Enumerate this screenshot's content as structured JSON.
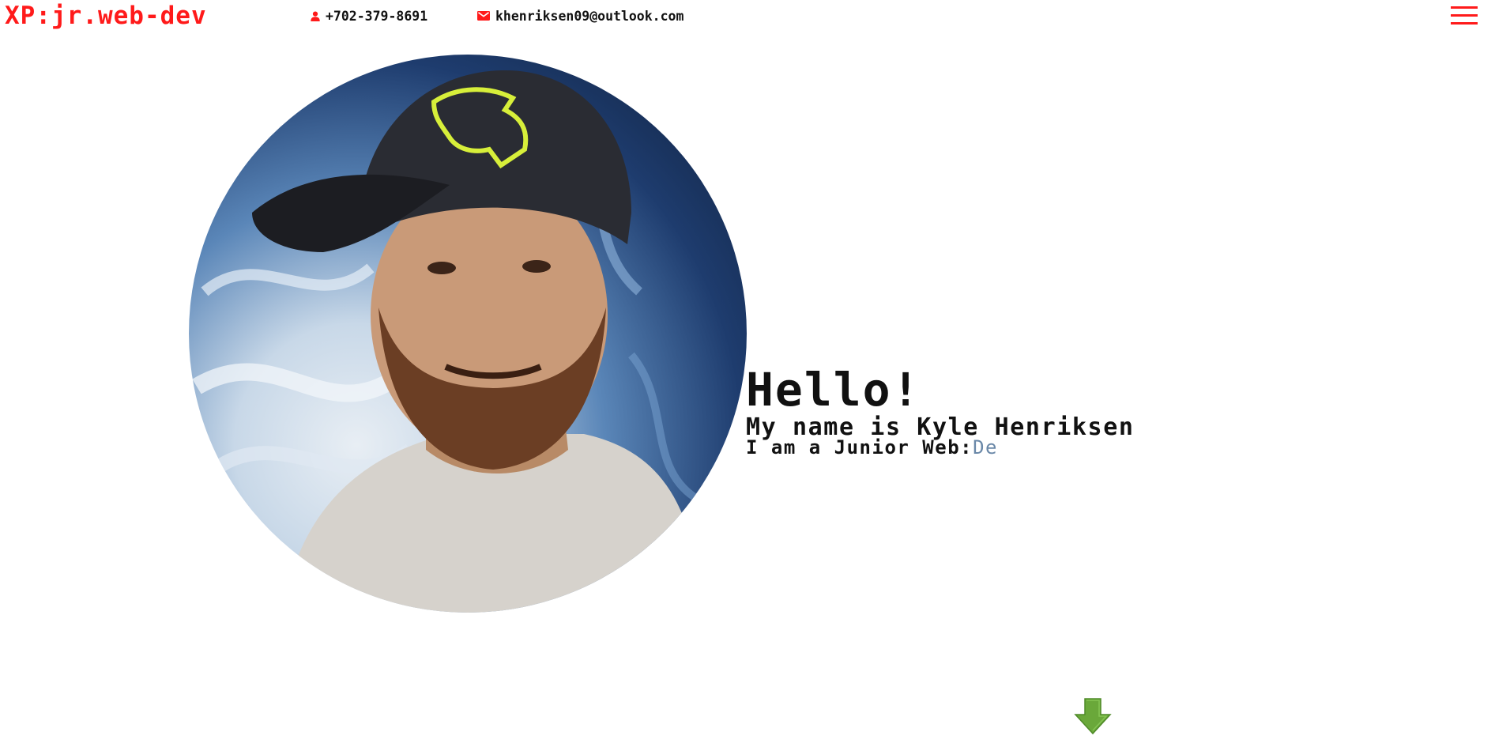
{
  "header": {
    "brand": "XP:jr.web-dev",
    "phone": "+702-379-8691",
    "email": "khenriksen09@outlook.com",
    "phone_icon": "person-icon",
    "email_icon": "envelope-icon",
    "menu_icon": "hamburger-menu-icon"
  },
  "hero": {
    "avatar_icon": "profile-photo",
    "greeting": "Hello!",
    "name_line": "My name is Kyle Henriksen",
    "role_prefix": "I am a Junior Web:",
    "role_typed": "De",
    "scroll_icon": "down-arrow-icon"
  },
  "colors": {
    "accent": "#ff1a1a",
    "text": "#111111",
    "arrow": "#6aa83a"
  }
}
